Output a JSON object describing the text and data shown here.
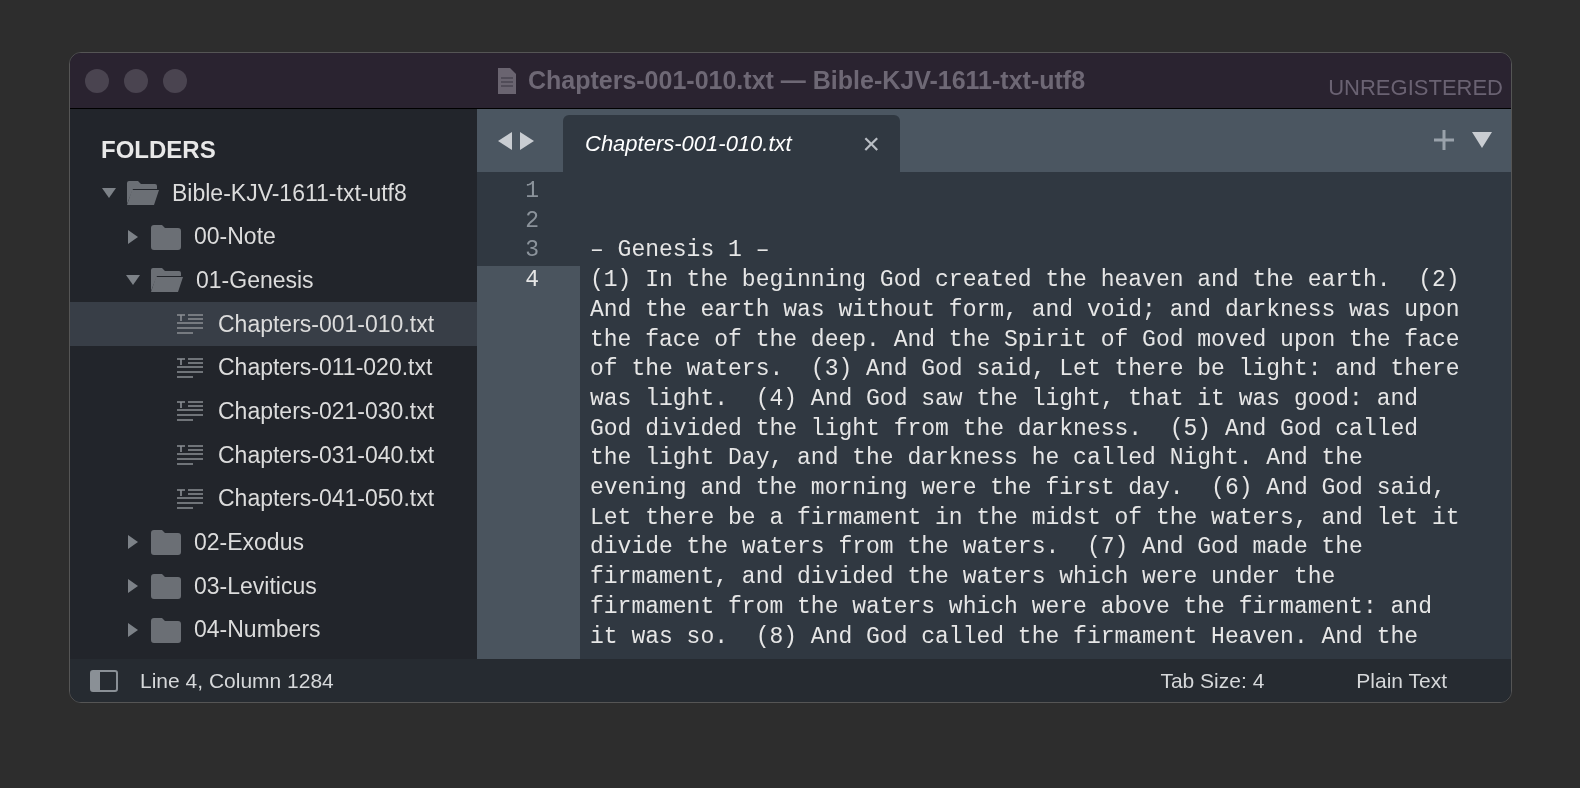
{
  "window": {
    "title": "Chapters-001-010.txt — Bible-KJV-1611-txt-utf8",
    "badge": "UNREGISTERED"
  },
  "sidebar": {
    "heading": "FOLDERS",
    "tree": [
      {
        "kind": "folder",
        "label": "Bible-KJV-1611-txt-utf8",
        "expanded": true,
        "selected": false,
        "children": [
          {
            "kind": "folder",
            "label": "00-Note",
            "expanded": false,
            "selected": false
          },
          {
            "kind": "folder",
            "label": "01-Genesis",
            "expanded": true,
            "selected": false,
            "children": [
              {
                "kind": "file",
                "label": "Chapters-001-010.txt",
                "selected": true
              },
              {
                "kind": "file",
                "label": "Chapters-011-020.txt",
                "selected": false
              },
              {
                "kind": "file",
                "label": "Chapters-021-030.txt",
                "selected": false
              },
              {
                "kind": "file",
                "label": "Chapters-031-040.txt",
                "selected": false
              },
              {
                "kind": "file",
                "label": "Chapters-041-050.txt",
                "selected": false
              }
            ]
          },
          {
            "kind": "folder",
            "label": "02-Exodus",
            "expanded": false,
            "selected": false
          },
          {
            "kind": "folder",
            "label": "03-Leviticus",
            "expanded": false,
            "selected": false
          },
          {
            "kind": "folder",
            "label": "04-Numbers",
            "expanded": false,
            "selected": false
          }
        ]
      }
    ]
  },
  "tabs": [
    {
      "label": "Chapters-001-010.txt",
      "selected": true,
      "close": "×"
    }
  ],
  "editor": {
    "lines": [
      {
        "number": "1",
        "current": false
      },
      {
        "number": "2",
        "current": false
      },
      {
        "number": "3",
        "current": false,
        "wrapped": [
          "– Genesis 1 –"
        ]
      },
      {
        "number": "4",
        "current": true,
        "wrapped": [
          "(1) In the beginning God created the heaven and the earth.  (2)",
          "And the earth was without form, and void; and darkness was upon",
          "the face of the deep. And the Spirit of God moved upon the face",
          "of the waters.  (3) And God said, Let there be light: and there",
          "was light.  (4) And God saw the light, that it was good: and",
          "God divided the light from the darkness.  (5) And God called",
          "the light Day, and the darkness he called Night. And the",
          "evening and the morning were the first day.  (6) And God said,",
          "Let there be a firmament in the midst of the waters, and let it",
          "divide the waters from the waters.  (7) And God made the",
          "firmament, and divided the waters which were under the",
          "firmament from the waters which were above the firmament: and",
          "it was so.  (8) And God called the firmament Heaven. And the"
        ]
      }
    ]
  },
  "status_bar": {
    "position": "Line 4, Column 1284",
    "tab_size": "Tab Size: 4",
    "syntax": "Plain Text"
  }
}
